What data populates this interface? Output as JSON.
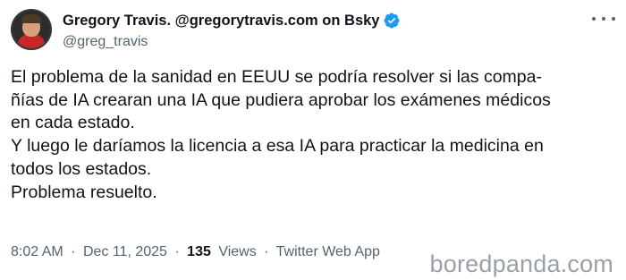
{
  "author": {
    "display_name": "Gregory Travis. @gregorytravis.com on Bsky",
    "handle": "@greg_travis"
  },
  "tweet": {
    "lines": [
      "El problema de la sanidad en EEUU se podría resolver si las compa-",
      "ñías de IA crearan una IA que pudiera aprobar los exámenes médicos",
      "en cada estado.",
      "Y luego le daríamos la licencia a esa IA para practicar la medicina en",
      "todos los estados.",
      "Problema resuelto."
    ]
  },
  "meta": {
    "time": "8:02 AM",
    "date": "Dec 11, 2025",
    "views_count": "135",
    "views_label": "Views",
    "client": "Twitter Web App",
    "separator": "·"
  },
  "watermark": "boredpanda.com",
  "icons": {
    "verified": "verified-badge-icon",
    "more": "more-options-icon"
  },
  "colors": {
    "verified": "#1d9bf0",
    "secondary_text": "#536471",
    "primary_text": "#0f1419"
  }
}
